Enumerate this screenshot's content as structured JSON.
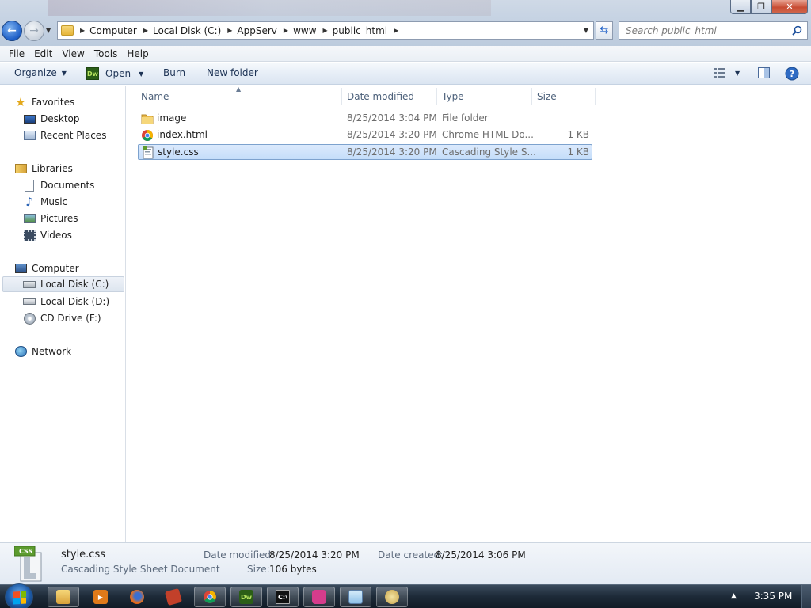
{
  "address": {
    "crumbs": [
      "Computer",
      "Local Disk (C:)",
      "AppServ",
      "www",
      "public_html"
    ]
  },
  "search": {
    "placeholder": "Search public_html"
  },
  "menu": [
    "File",
    "Edit",
    "View",
    "Tools",
    "Help"
  ],
  "commands": {
    "organize": "Organize",
    "open": "Open",
    "open_app_badge": "Dw",
    "burn": "Burn",
    "new_folder": "New folder"
  },
  "nav": {
    "favorites": "Favorites",
    "desktop": "Desktop",
    "recent_places": "Recent Places",
    "libraries": "Libraries",
    "documents": "Documents",
    "music": "Music",
    "pictures": "Pictures",
    "videos": "Videos",
    "computer": "Computer",
    "local_disk_c": "Local Disk (C:)",
    "local_disk_d": "Local Disk (D:)",
    "cd_drive": "CD Drive (F:)",
    "network": "Network"
  },
  "columns": {
    "name": "Name",
    "date": "Date modified",
    "type": "Type",
    "size": "Size"
  },
  "files": [
    {
      "name": "image",
      "date": "8/25/2014 3:04 PM",
      "type": "File folder",
      "size": "",
      "icon": "folder-icon"
    },
    {
      "name": "index.html",
      "date": "8/25/2014 3:20 PM",
      "type": "Chrome HTML Do...",
      "size": "1 KB",
      "icon": "chrome-icon"
    },
    {
      "name": "style.css",
      "date": "8/25/2014 3:20 PM",
      "type": "Cascading Style S...",
      "size": "1 KB",
      "icon": "css-file-icon",
      "selected": true
    }
  ],
  "details": {
    "badge": "CSS",
    "name": "style.css",
    "type": "Cascading Style Sheet Document",
    "date_modified_label": "Date modified:",
    "date_modified": "8/25/2014 3:20 PM",
    "date_created_label": "Date created:",
    "date_created": "8/25/2014 3:06 PM",
    "size_label": "Size:",
    "size": "106 bytes"
  },
  "taskbar": {
    "cmd_badge": "C:\\",
    "clock": "3:35 PM"
  },
  "colors": {
    "selection": "#c4ddfa",
    "selection_border": "#7da2ce",
    "close_button": "#c84c33",
    "taskbar": "#1d2a38"
  }
}
